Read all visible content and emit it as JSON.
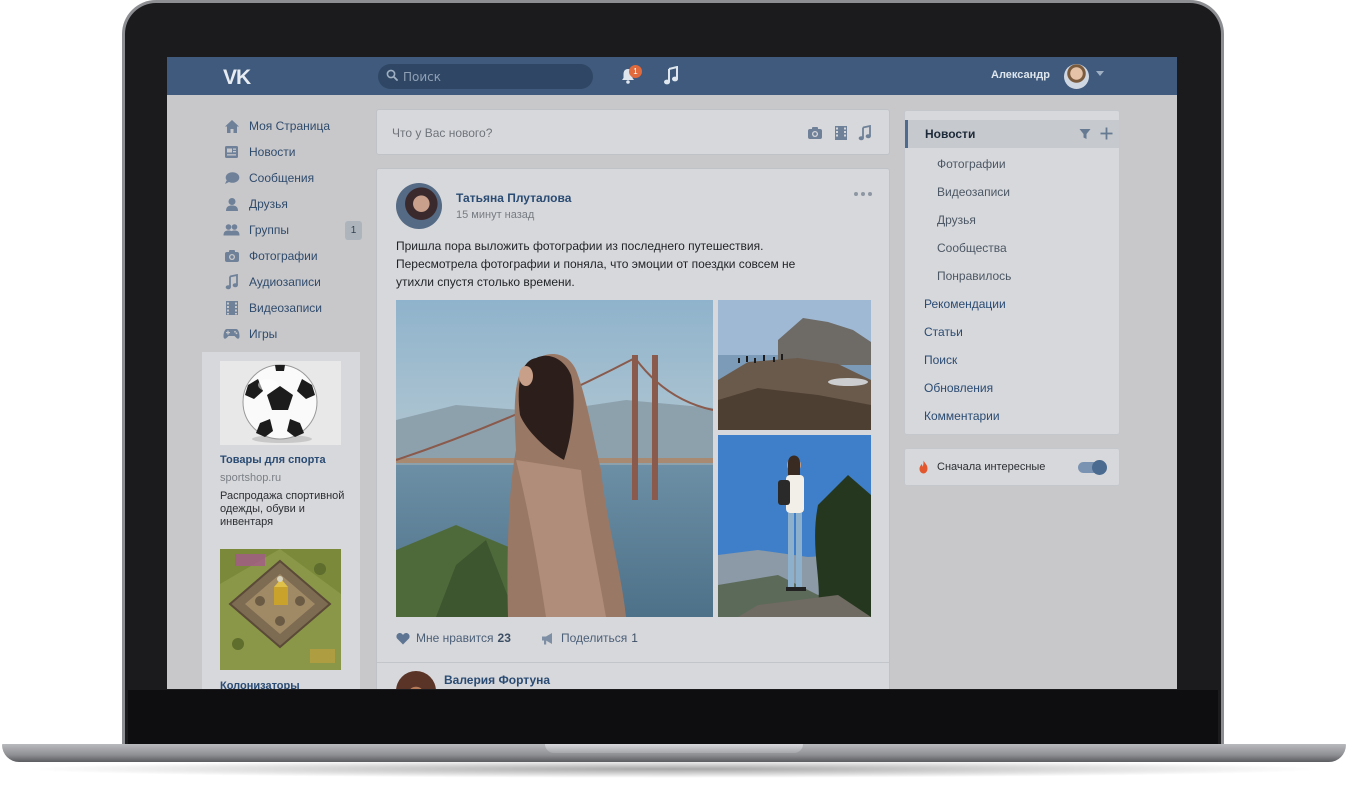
{
  "header": {
    "logo": "VK",
    "search_placeholder": "Поиск",
    "notifications_count": "1",
    "user_name": "Александр"
  },
  "left_nav": {
    "items": [
      {
        "label": "Моя Страница",
        "icon": "home-icon"
      },
      {
        "label": "Новости",
        "icon": "news-icon"
      },
      {
        "label": "Сообщения",
        "icon": "messages-icon"
      },
      {
        "label": "Друзья",
        "icon": "friends-icon"
      },
      {
        "label": "Группы",
        "icon": "groups-icon",
        "badge": "1"
      },
      {
        "label": "Фотографии",
        "icon": "camera-icon"
      },
      {
        "label": "Аудиозаписи",
        "icon": "music-icon"
      },
      {
        "label": "Видеозаписи",
        "icon": "video-icon"
      },
      {
        "label": "Игры",
        "icon": "gamepad-icon"
      }
    ]
  },
  "ads": [
    {
      "title": "Товары для спорта",
      "url": "sportshop.ru",
      "description": "Распродажа спортивной одежды, обуви и инвентаря"
    },
    {
      "title": "Колонизаторы"
    }
  ],
  "composer": {
    "placeholder": "Что у Вас нового?"
  },
  "post": {
    "author": "Татьяна Плуталова",
    "time": "15 минут назад",
    "text": "Пришла пора выложить фотографии из последнего путешествия. Пересмотрела фотографии и поняла, что эмоции от поездки совсем не утихли спустя столько времени.",
    "like_label": "Мне нравится",
    "like_count": "23",
    "share_label": "Поделиться",
    "share_count": "1"
  },
  "next_post": {
    "author": "Валерия Фортуна"
  },
  "right_menu": {
    "active": "Новости",
    "sub_items": [
      "Фотографии",
      "Видеозаписи",
      "Друзья",
      "Сообщества",
      "Понравилось"
    ],
    "main_items": [
      "Рекомендации",
      "Статьи",
      "Поиск",
      "Обновления",
      "Комментарии"
    ]
  },
  "interesting": {
    "label": "Сначала интересные",
    "enabled": true
  },
  "colors": {
    "header_bg": "#3f5a7c",
    "link": "#2a4b73",
    "badge": "#e06a3c"
  }
}
